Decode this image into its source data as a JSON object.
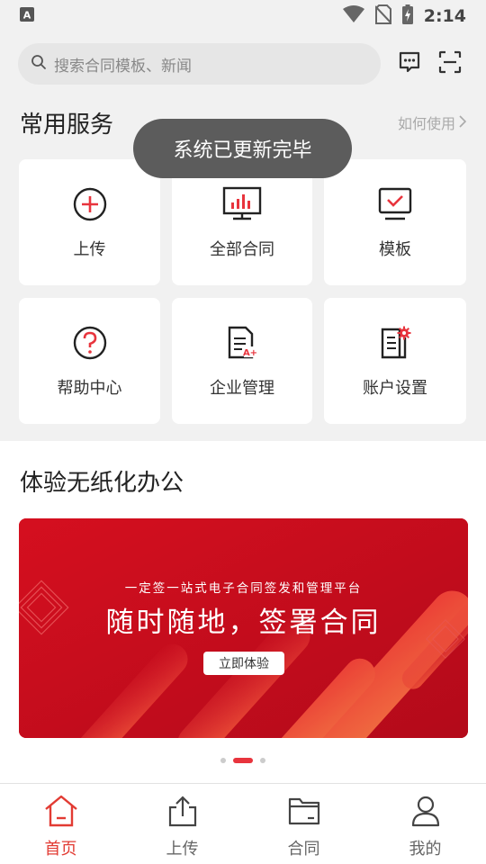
{
  "status_bar": {
    "time": "2:14",
    "app_badge": "A"
  },
  "search": {
    "placeholder": "搜索合同模板、新闻"
  },
  "common_services": {
    "title": "常用服务",
    "how_to_label": "如何使用",
    "items": [
      {
        "label": "上传",
        "icon": "plus-circle-icon"
      },
      {
        "label": "全部合同",
        "icon": "monitor-chart-icon"
      },
      {
        "label": "模板",
        "icon": "monitor-check-icon"
      },
      {
        "label": "帮助中心",
        "icon": "question-circle-icon"
      },
      {
        "label": "企业管理",
        "icon": "document-a-plus-icon"
      },
      {
        "label": "账户设置",
        "icon": "document-gear-icon"
      }
    ]
  },
  "toast": {
    "text": "系统已更新完毕"
  },
  "paperless": {
    "title": "体验无纸化办公"
  },
  "banner": {
    "subtitle": "一定签一站式电子合同签发和管理平台",
    "headline": "随时随地，签署合同",
    "button_label": "立即体验",
    "carousel_total": 3,
    "carousel_active": 2
  },
  "bottom_nav": [
    {
      "label": "首页",
      "icon": "home-icon",
      "active": true
    },
    {
      "label": "上传",
      "icon": "upload-icon",
      "active": false
    },
    {
      "label": "合同",
      "icon": "folder-icon",
      "active": false
    },
    {
      "label": "我的",
      "icon": "user-icon",
      "active": false
    }
  ],
  "colors": {
    "accent": "#e23b33",
    "banner_red": "#d30d1e",
    "toast_bg": "#5c5c5c"
  }
}
